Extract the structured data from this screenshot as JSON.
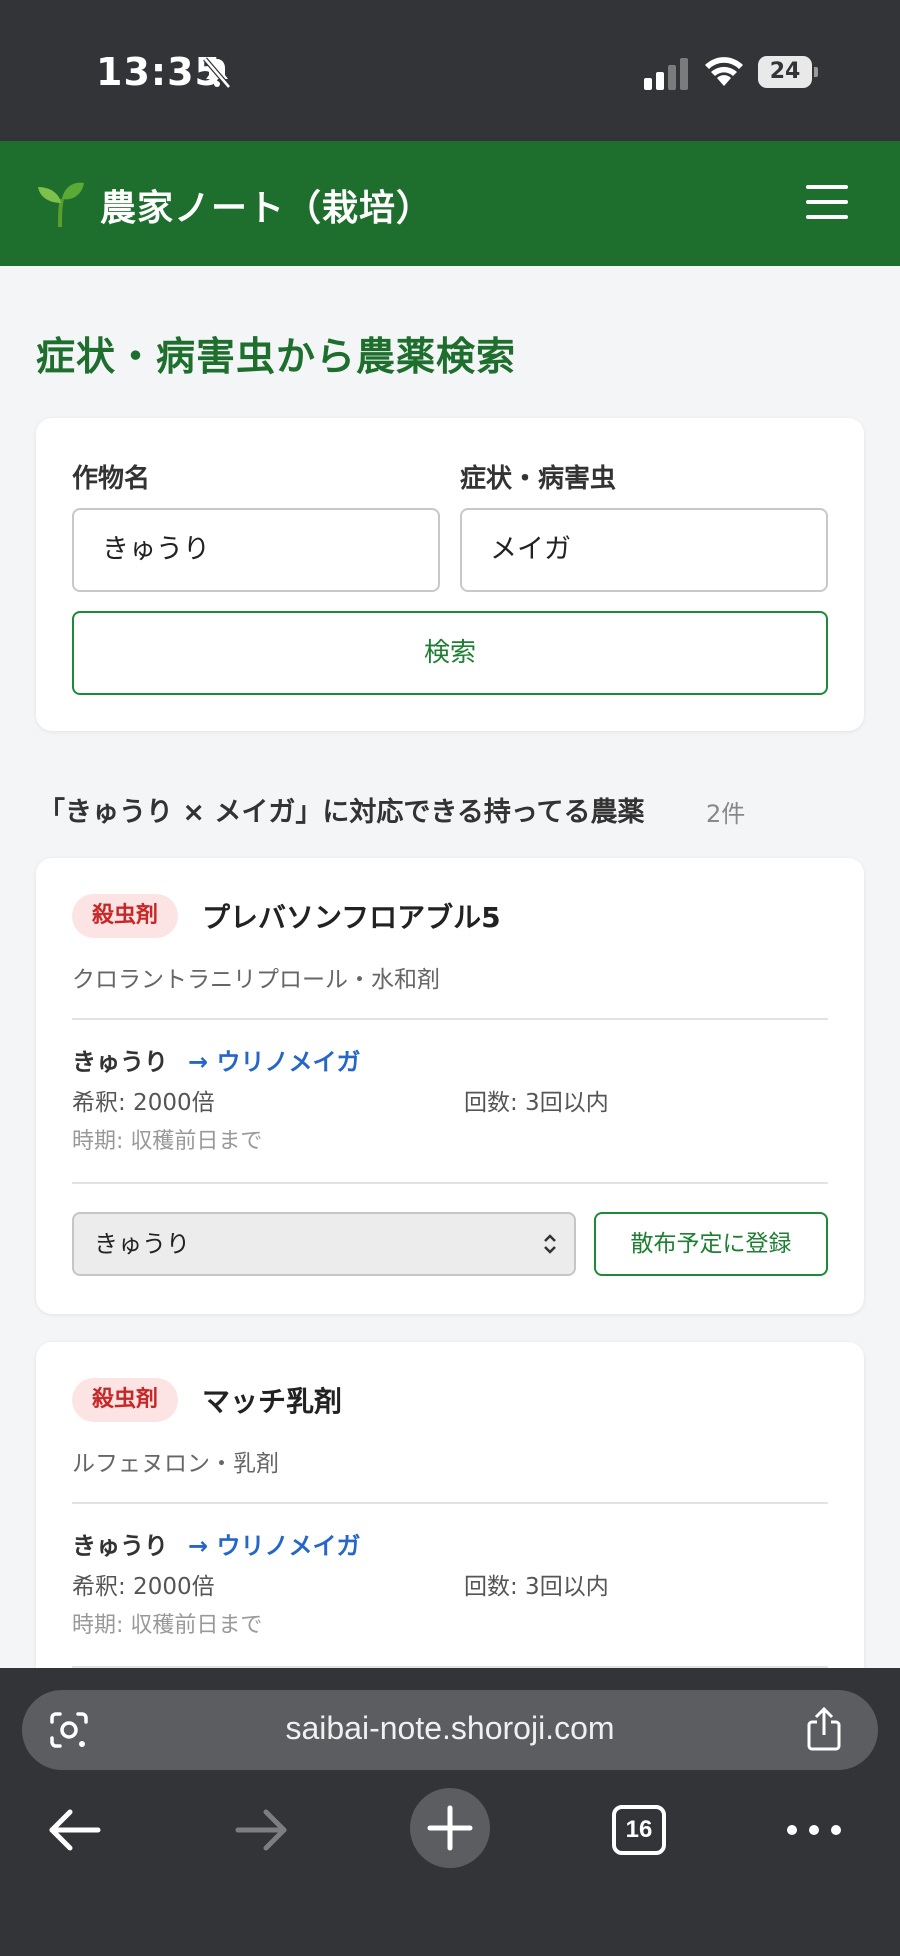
{
  "status": {
    "time": "13:35",
    "battery": "24"
  },
  "header": {
    "title": "農家ノート（栽培）"
  },
  "page": {
    "title": "症状・病害虫から農薬検索"
  },
  "search": {
    "crop_label": "作物名",
    "crop_value": "きゅうり",
    "symptom_label": "症状・病害虫",
    "symptom_value": "メイガ",
    "button_label": "検索"
  },
  "results": {
    "heading": "「きゅうり × メイガ」に対応できる持ってる農薬",
    "count": "2件",
    "items": [
      {
        "badge": "殺虫剤",
        "name": "プレバソンフロアブル5",
        "ingredient": "クロラントラニリプロール・水和剤",
        "crop": "きゅうり",
        "target": "→ ウリノメイガ",
        "dilution": "希釈: 2000倍",
        "times": "回数: 3回以内",
        "timing": "時期: 収穫前日まで",
        "select_value": "きゅうり",
        "register_label": "散布予定に登録"
      },
      {
        "badge": "殺虫剤",
        "name": "マッチ乳剤",
        "ingredient": "ルフェヌロン・乳剤",
        "crop": "きゅうり",
        "target": "→ ウリノメイガ",
        "dilution": "希釈: 2000倍",
        "times": "回数: 3回以内",
        "timing": "時期: 収穫前日まで"
      }
    ]
  },
  "browser": {
    "url": "saibai-note.shoroji.com",
    "tab_count": "16"
  },
  "colors": {
    "header_green": "#1e6f2e",
    "accent_green": "#1e8a38",
    "badge_red": "#c62828",
    "link_blue": "#2666c9"
  }
}
